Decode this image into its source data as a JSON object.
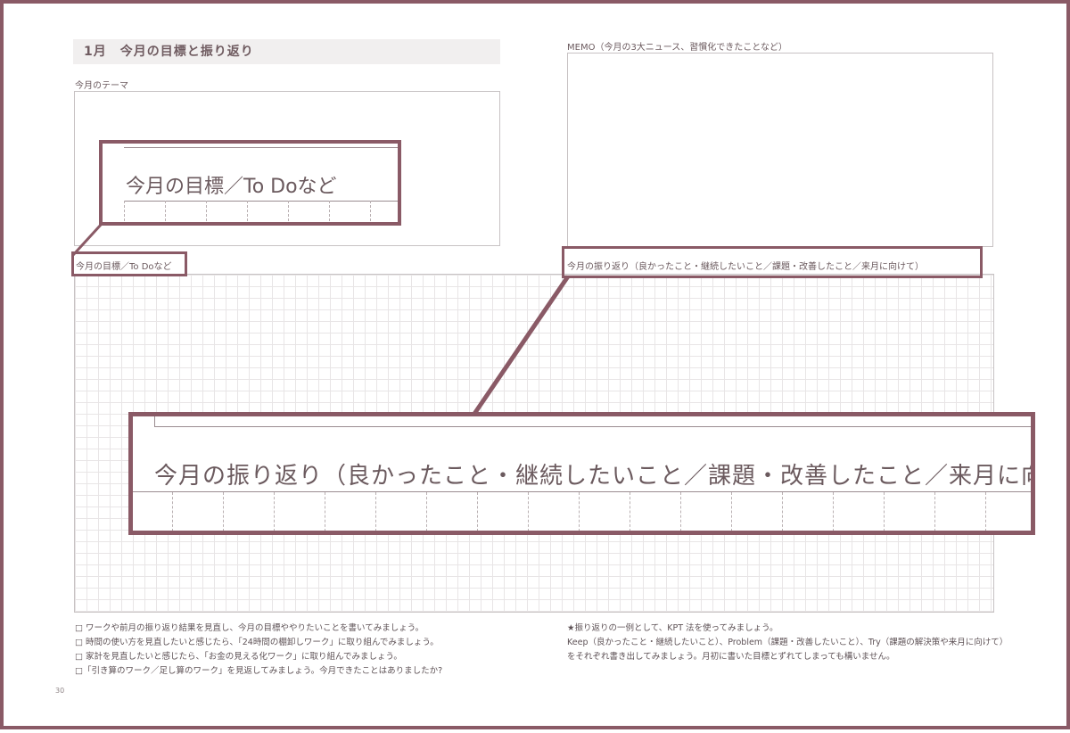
{
  "header": {
    "title": "1月　今月の目標と振り返り"
  },
  "sections": {
    "theme_label": "今月のテーマ",
    "memo_label": "MEMO（今月の3大ニュース、習慣化できたことなど）",
    "goal_label": "今月の目標／To Doなど",
    "review_label": "今月の振り返り（良かったこと・継続したいこと／課題・改善したこと／来月に向けて）"
  },
  "zoom": {
    "goal_text": "今月の目標／To Doなど",
    "review_text": "今月の振り返り（良かったこと・継続したいこと／課題・改善したこと／来月に向けて）"
  },
  "notes_left": [
    "□ ワークや前月の振り返り結果を見直し、今月の目標ややりたいことを書いてみましょう。",
    "□ 時間の使い方を見直したいと感じたら、「24時間の棚卸しワーク」に取り組んでみましょう。",
    "□ 家計を見直したいと感じたら、「お金の見える化ワーク」に取り組んでみましょう。",
    "□「引き算のワーク／足し算のワーク」を見返してみましょう。今月できたことはありましたか?"
  ],
  "notes_right": [
    "★振り返りの一例として、KPT 法を使ってみましょう。",
    "Keep（良かったこと・継続したいこと）、Problem（課題・改善したいこと）、Try（課題の解決策や来月に向けて）",
    "をそれぞれ書き出してみましょう。月初に書いた目標とずれてしまっても構いません。"
  ],
  "page_number": "30",
  "colors": {
    "accent": "#8a5a66",
    "text": "#6b5a5e",
    "grid": "#e8e5e6"
  }
}
